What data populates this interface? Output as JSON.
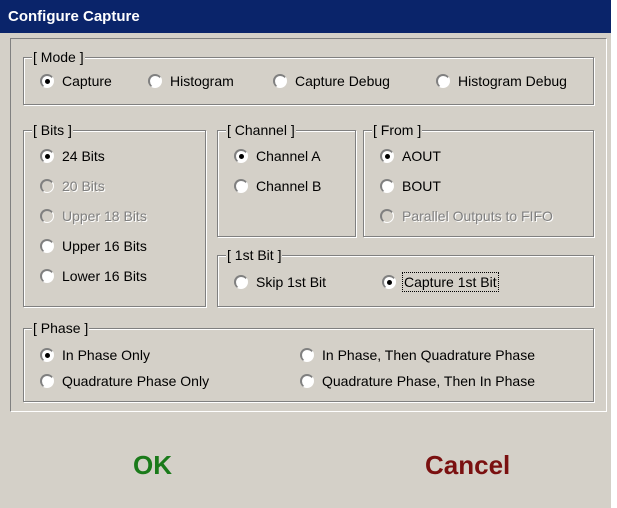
{
  "window": {
    "title": "Configure Capture"
  },
  "mode": {
    "legend": "[ Mode ]",
    "options": [
      "Capture",
      "Histogram",
      "Capture Debug",
      "Histogram Debug"
    ],
    "selected": "Capture"
  },
  "bits": {
    "legend": "[ Bits ]",
    "options": [
      "24 Bits",
      "20 Bits",
      "Upper 18 Bits",
      "Upper 16 Bits",
      "Lower 16 Bits"
    ],
    "disabled": [
      "20 Bits",
      "Upper 18 Bits"
    ],
    "selected": "24 Bits"
  },
  "channel": {
    "legend": "[ Channel ]",
    "options": [
      "Channel A",
      "Channel B"
    ],
    "selected": "Channel A"
  },
  "from": {
    "legend": "[ From ]",
    "options": [
      "AOUT",
      "BOUT",
      "Parallel Outputs to FIFO"
    ],
    "disabled": [
      "Parallel Outputs to FIFO"
    ],
    "selected": "AOUT"
  },
  "first_bit": {
    "legend": "[ 1st Bit ]",
    "options": [
      "Skip 1st Bit",
      "Capture 1st Bit"
    ],
    "selected": "Capture 1st Bit"
  },
  "phase": {
    "legend": "[ Phase ]",
    "options": [
      "In Phase Only",
      "Quadrature Phase Only",
      "In Phase, Then Quadrature Phase",
      "Quadrature Phase, Then In Phase"
    ],
    "selected": "In Phase Only"
  },
  "buttons": {
    "ok": "OK",
    "cancel": "Cancel"
  },
  "colors": {
    "titlebar": "#0a246a",
    "ok": "#1a7a1a",
    "cancel": "#7a1010",
    "face": "#d4d0c8"
  }
}
